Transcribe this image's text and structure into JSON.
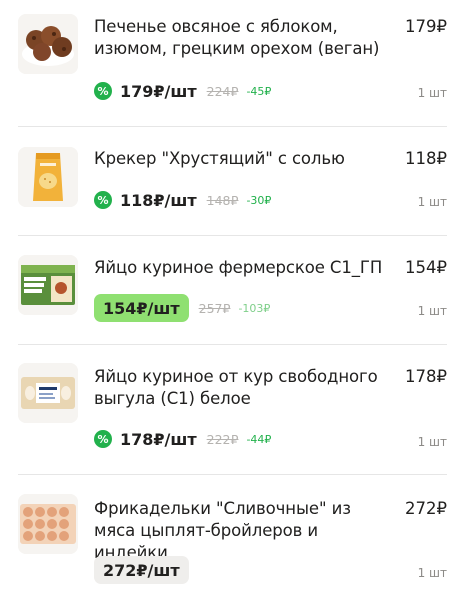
{
  "items": [
    {
      "name": "Печенье овсяное с яблоком, изюмом, грецким орехом (веган)",
      "price": "179₽",
      "current_price": "179₽/шт",
      "old_price": "224₽",
      "saving": "-45₽",
      "quantity": "1 шт",
      "discount_icon": "percent-icon",
      "image": "oat-cookies-image"
    },
    {
      "name": "Крекер \"Хрустящий\" с солью",
      "price": "118₽",
      "current_price": "118₽/шт",
      "old_price": "148₽",
      "saving": "-30₽",
      "quantity": "1 шт",
      "discount_icon": "percent-icon",
      "image": "crackers-pack-image"
    },
    {
      "name": "Яйцо куриное фермерское С1_ГП",
      "price": "154₽",
      "current_price": "154₽/шт",
      "old_price": "257₽",
      "saving": "-103₽",
      "quantity": "1 шт",
      "price_style": "highlight",
      "image": "farm-eggs-box-image"
    },
    {
      "name": "Яйцо куриное от кур свободного выгула (С1) белое",
      "price": "178₽",
      "current_price": "178₽/шт",
      "old_price": "222₽",
      "saving": "-44₽",
      "quantity": "1 шт",
      "discount_icon": "percent-icon",
      "image": "free-range-eggs-image"
    },
    {
      "name": "Фрикадельки \"Сливочные\" из мяса цыплят-бройлеров и индейки",
      "price": "272₽",
      "current_price": "272₽/шт",
      "quantity": "1 шт",
      "price_style": "plain",
      "image": "meatballs-tray-image"
    }
  ],
  "colors": {
    "discount_green": "#22b14c",
    "highlight_green": "#8fe071",
    "muted": "#b5b3b0"
  }
}
